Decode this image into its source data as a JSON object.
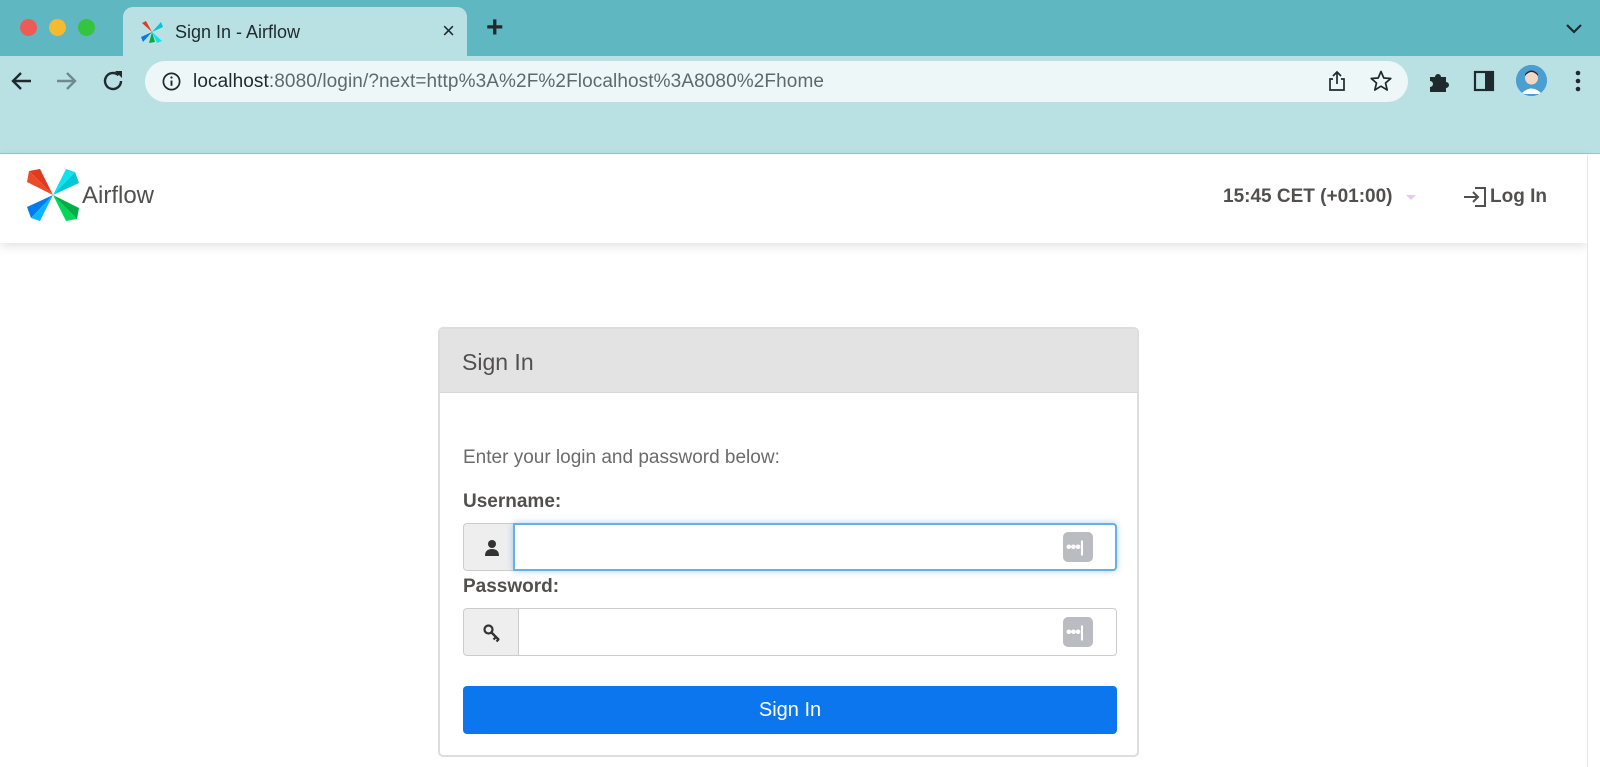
{
  "browser": {
    "tab_title": "Sign In - Airflow",
    "tab_close": "×",
    "new_tab": "+",
    "url_host": "localhost",
    "url_rest": ":8080/login/?next=http%3A%2F%2Flocalhost%3A8080%2Fhome"
  },
  "navbar": {
    "brand": "Airflow",
    "clock": "15:45 CET (+01:00)",
    "login_label": "Log In"
  },
  "panel": {
    "title": "Sign In",
    "intro": "Enter your login and password below:",
    "username_label": "Username:",
    "username_value": "",
    "password_label": "Password:",
    "password_value": "",
    "password_manager_glyph": "•••|",
    "submit_label": "Sign In"
  },
  "colors": {
    "tabstrip": "#5fb8c1",
    "toolbar": "#b9e1e4",
    "primary_button": "#0c76ee",
    "focus_border": "#66afe9"
  }
}
